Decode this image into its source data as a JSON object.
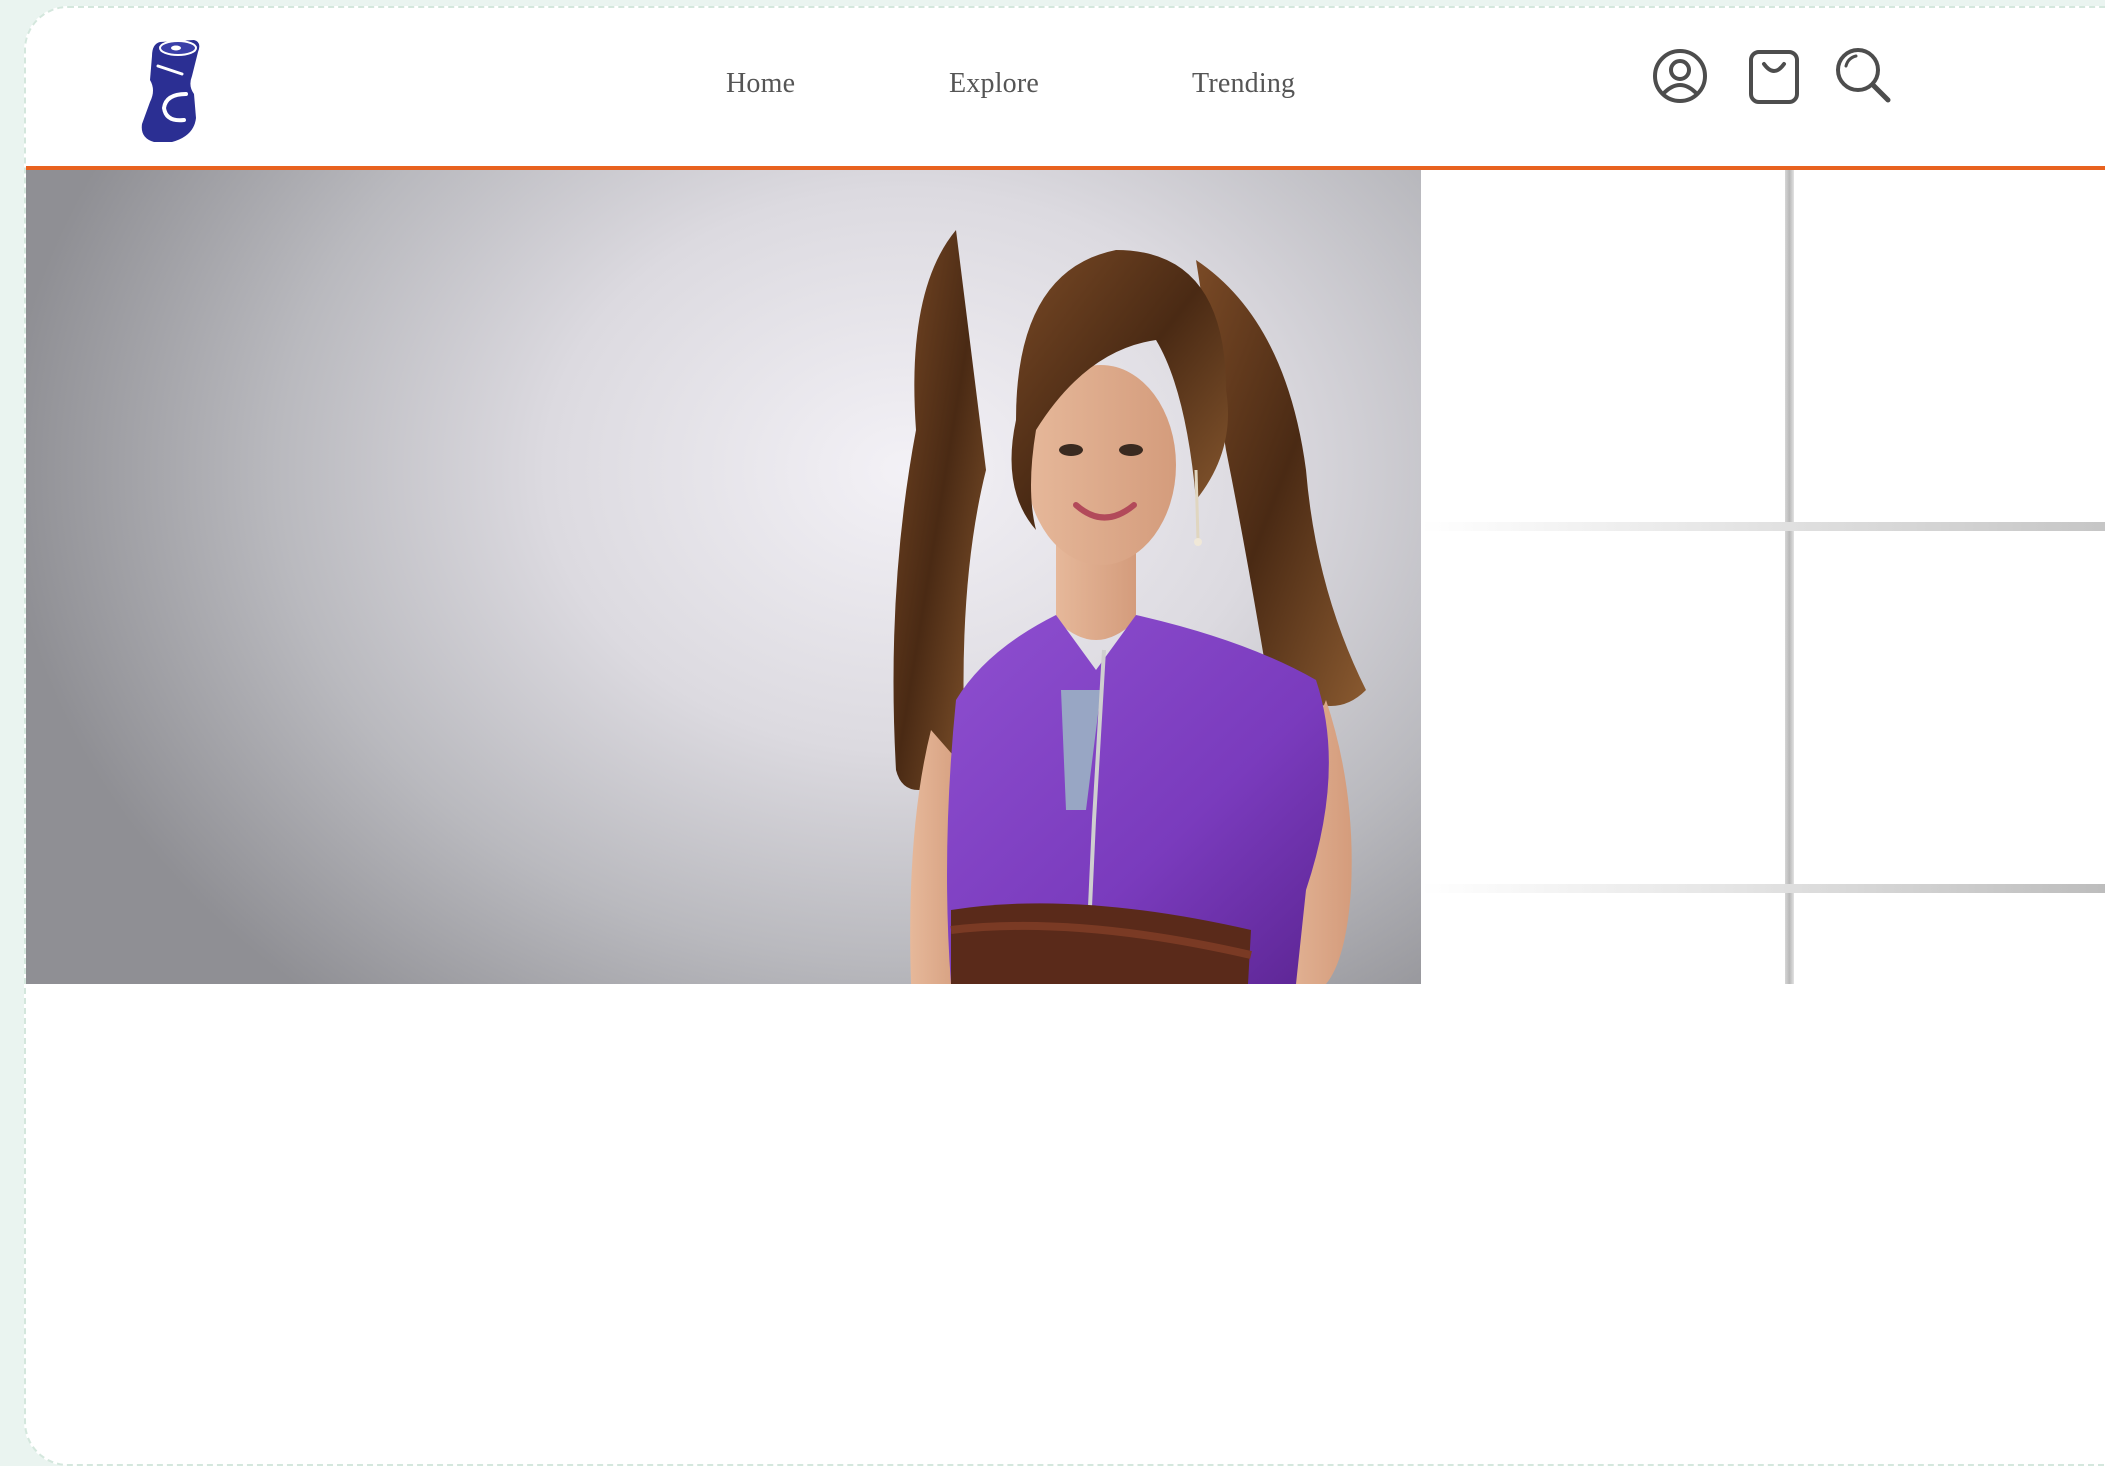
{
  "nav": {
    "links": [
      {
        "label": "Home"
      },
      {
        "label": "Explore"
      },
      {
        "label": "Trending"
      }
    ]
  },
  "header": {
    "logo_icon": "crushed-can-logo",
    "accent_color": "#e8621f",
    "logo_color": "#2b2f93",
    "icons": [
      "account-icon",
      "shopping-bag-icon",
      "search-icon"
    ]
  },
  "hero": {
    "image_subject": "woman-in-purple-dress",
    "dress_color": "#7a3bbd"
  }
}
